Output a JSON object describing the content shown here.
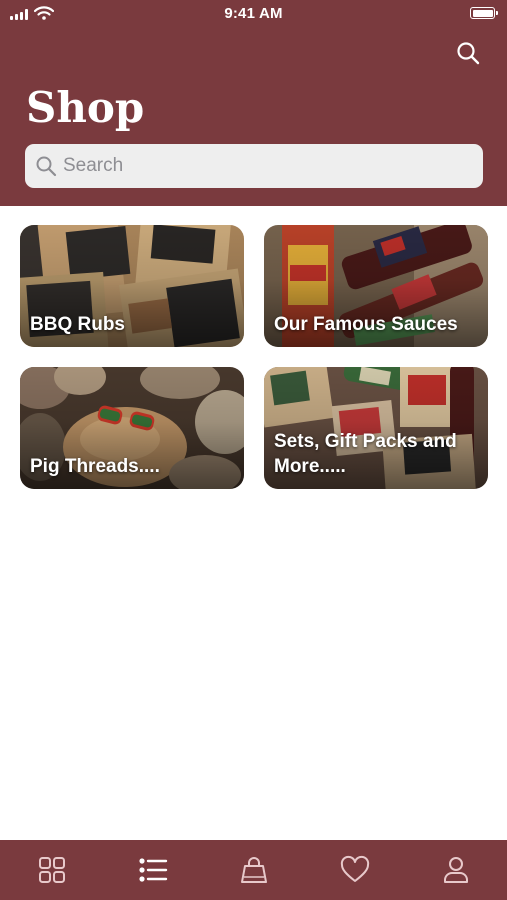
{
  "status_bar": {
    "time": "9:41 AM"
  },
  "header": {
    "title": "Shop"
  },
  "search": {
    "placeholder": "Search",
    "value": ""
  },
  "categories": [
    {
      "label": "BBQ Rubs"
    },
    {
      "label": "Our Famous Sauces"
    },
    {
      "label": "Pig Threads...."
    },
    {
      "label": "Sets, Gift Packs and More....."
    }
  ],
  "tab_bar": {
    "tabs": [
      {
        "icon": "grid-icon",
        "selected": false
      },
      {
        "icon": "list-icon",
        "selected": true
      },
      {
        "icon": "shopping-bag-icon",
        "selected": false
      },
      {
        "icon": "heart-icon",
        "selected": false
      },
      {
        "icon": "profile-icon",
        "selected": false
      }
    ]
  },
  "colors": {
    "brand": "#7a3a3e",
    "tab_icon_inactive": "#e8c9cb",
    "tab_icon_active": "#ffffff",
    "search_field": "#eeeeee"
  }
}
